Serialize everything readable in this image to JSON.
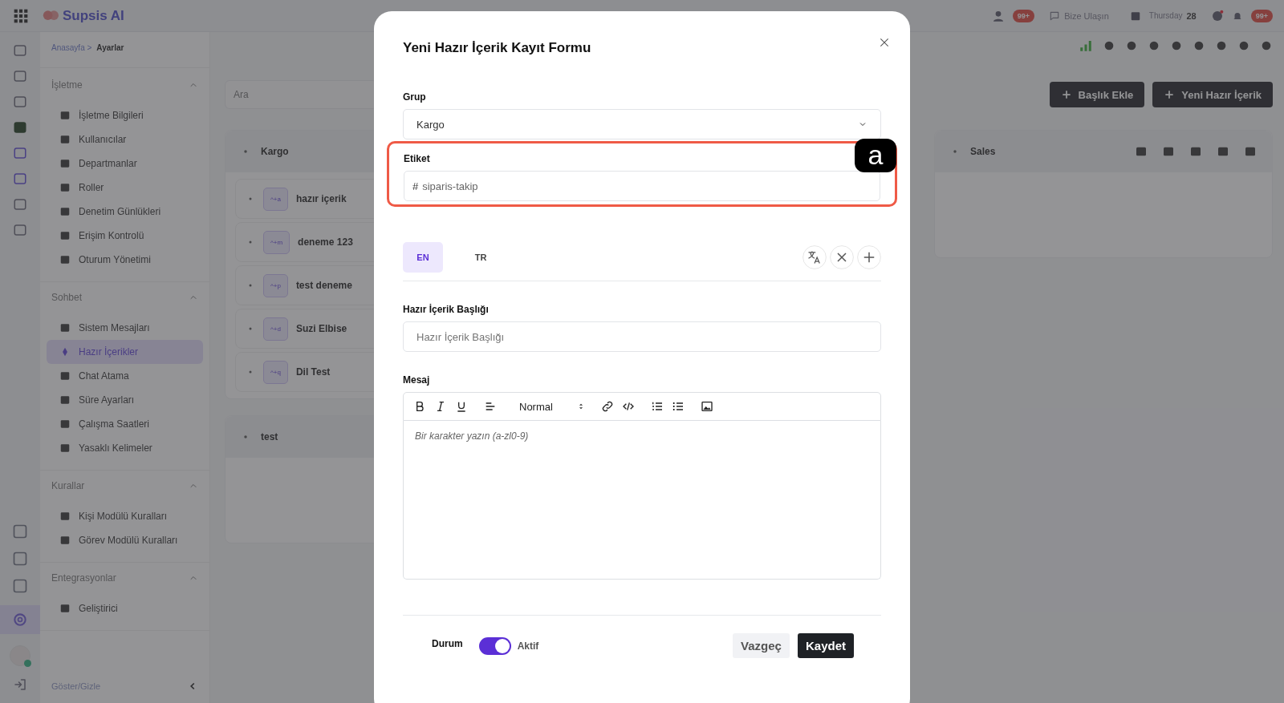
{
  "top_bar": {
    "logo": "Supsis AI",
    "badges": [
      "99+",
      "99+"
    ],
    "contact": "Bize Ulaşın",
    "day": "Thursday",
    "date": "28"
  },
  "breadcrumb": [
    {
      "label": "Anasayfa >",
      "current": false
    },
    {
      "label": "Ayarlar",
      "current": true
    }
  ],
  "sidebar": {
    "sections": [
      {
        "title": "İşletme",
        "expanded": true,
        "items": [
          {
            "label": "İşletme Bilgileri",
            "selected": false
          },
          {
            "label": "Kullanıcılar",
            "selected": false
          },
          {
            "label": "Departmanlar",
            "selected": false
          },
          {
            "label": "Roller",
            "selected": false
          },
          {
            "label": "Denetim Günlükleri",
            "selected": false
          },
          {
            "label": "Erişim Kontrolü",
            "selected": false
          },
          {
            "label": "Oturum Yönetimi",
            "selected": false
          }
        ]
      },
      {
        "title": "Sohbet",
        "expanded": true,
        "items": [
          {
            "label": "Sistem Mesajları",
            "selected": false
          },
          {
            "label": "Hazır İçerikler",
            "selected": true
          },
          {
            "label": "Chat Atama",
            "selected": false
          },
          {
            "label": "Süre Ayarları",
            "selected": false
          },
          {
            "label": "Çalışma Saatleri",
            "selected": false
          },
          {
            "label": "Yasaklı Kelimeler",
            "selected": false
          }
        ]
      },
      {
        "title": "Kurallar",
        "expanded": true,
        "items": [
          {
            "label": "Kişi Modülü Kuralları",
            "selected": false
          },
          {
            "label": "Görev Modülü Kuralları",
            "selected": false
          }
        ]
      },
      {
        "title": "Entegrasyonlar",
        "expanded": true,
        "items": [
          {
            "label": "Geliştirici",
            "selected": false
          }
        ]
      }
    ],
    "toggle_label": "Göster/Gizle"
  },
  "search": {
    "placeholder": "Ara"
  },
  "actions": [
    "Başlık Ekle",
    "Yeni Hazır İçerik"
  ],
  "groups": [
    {
      "title": "Kargo",
      "items": [
        {
          "shortcut": "^+a",
          "title": "hazır içerik"
        },
        {
          "shortcut": "^+m",
          "title": "deneme 123"
        },
        {
          "shortcut": "^+p",
          "title": "test deneme"
        },
        {
          "shortcut": "^+d",
          "title": "Suzi Elbise"
        },
        {
          "shortcut": "^+q",
          "title": "Dil Test"
        }
      ]
    },
    {
      "title": "test"
    },
    {
      "title": "Sales"
    }
  ],
  "modal": {
    "title": "Yeni Hazır İçerik Kayıt Formu",
    "fields": [
      {
        "kind": "select",
        "label": "Grup",
        "value": "Kargo",
        "highlighted": false
      },
      {
        "kind": "tag",
        "label": "Etiket",
        "prefix": "#",
        "value": "siparis-takip",
        "highlighted": true,
        "marker": "a"
      }
    ],
    "languages": [
      {
        "label": "EN",
        "selected": true
      },
      {
        "label": "TR",
        "selected": false
      }
    ],
    "title_field": {
      "label": "Hazır İçerik Başlığı",
      "placeholder": "Hazır İçerik Başlığı"
    },
    "message": {
      "label": "Mesaj",
      "format": "Normal",
      "placeholder": "Bir karakter yazın (a-zl0-9)"
    },
    "status": {
      "label": "Durum",
      "on": true,
      "text": "Aktif"
    },
    "buttons": [
      {
        "kind": "secondary",
        "label": "Vazgeç"
      },
      {
        "kind": "primary",
        "label": "Kaydet"
      }
    ]
  }
}
